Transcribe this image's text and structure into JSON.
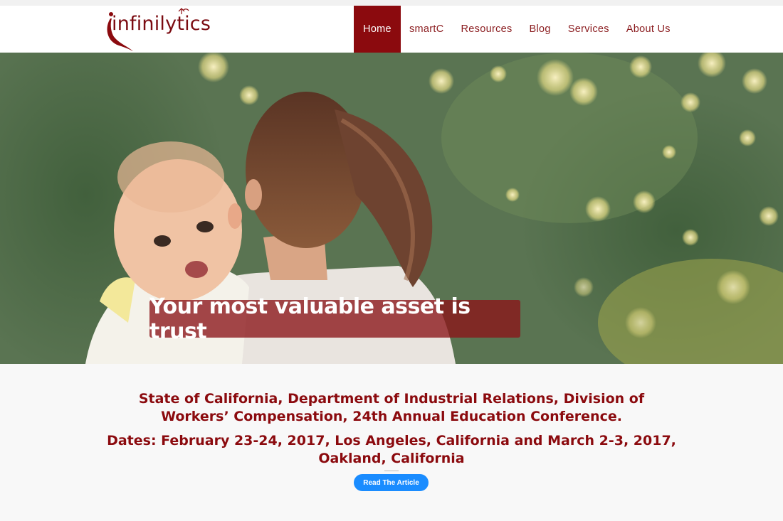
{
  "brand": {
    "name": "infinilytics",
    "color": "#7b0b11"
  },
  "nav": {
    "items": [
      {
        "label": "Home",
        "active": true
      },
      {
        "label": "smartC",
        "active": false
      },
      {
        "label": "Resources",
        "active": false
      },
      {
        "label": "Blog",
        "active": false
      },
      {
        "label": "Services",
        "active": false
      },
      {
        "label": "About Us",
        "active": false
      }
    ],
    "active_color": "#8b0a0e"
  },
  "hero": {
    "caption": "Your most valuable asset is trust"
  },
  "article": {
    "headline": "State of California, Department of Industrial Relations, Division of Workers’ Compensation, 24th Annual Education Conference.",
    "dates": "Dates: February 23-24, 2017, Los Angeles, California and March 2-3, 2017, Oakland, California",
    "button_label": "Read The Article",
    "button_color": "#1a8cff"
  }
}
